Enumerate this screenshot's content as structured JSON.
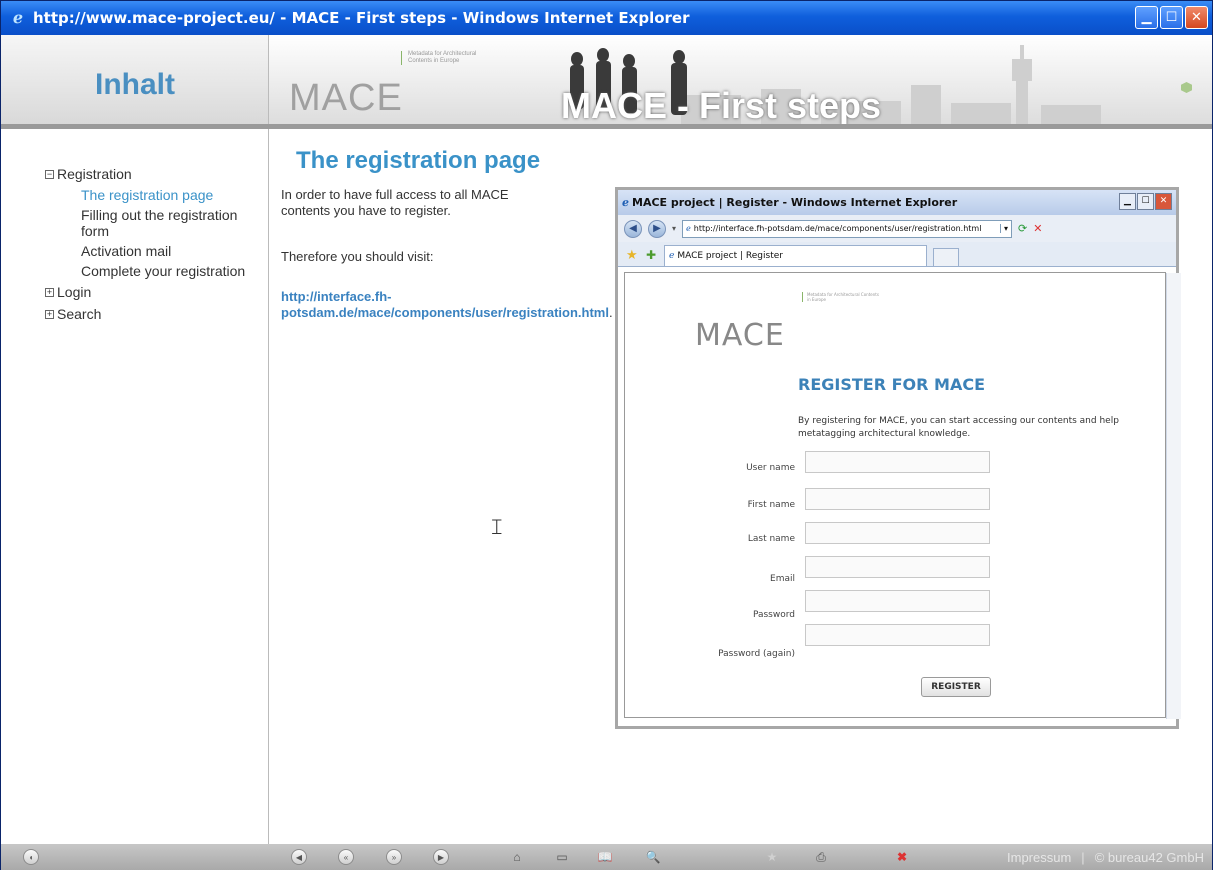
{
  "window": {
    "title": "http://www.mace-project.eu/ - MACE - First steps - Windows Internet Explorer"
  },
  "header": {
    "inhalt": "Inhalt",
    "logo": "MACE",
    "logo_tagline": "Metadata for Architectural Contents in Europe",
    "title": "MACE - First steps"
  },
  "nav": {
    "items": [
      {
        "box": "−",
        "label": "Registration",
        "children": [
          "The registration page",
          "Filling out the registration form",
          "Activation mail",
          "Complete your registration"
        ]
      },
      {
        "box": "+",
        "label": "Login"
      },
      {
        "box": "+",
        "label": "Search"
      }
    ]
  },
  "content": {
    "heading": "The registration page",
    "para1": "In order to have full access to all MACE contents you have to register.",
    "para2": "Therefore you should visit:",
    "link": "http://interface.fh-potsdam.de/mace/components/user/registration.html",
    "link_suffix": "."
  },
  "embedded_browser": {
    "title": "MACE project | Register - Windows Internet Explorer",
    "url": "http://interface.fh-potsdam.de/mace/components/user/registration.html",
    "tab": "MACE project | Register",
    "logo": "MACE",
    "logo_tagline": "Metadata for Architectural Contents in Europe",
    "heading": "REGISTER FOR MACE",
    "description": "By registering for MACE, you can start accessing our contents and help metatagging architectural knowledge.",
    "fields": [
      "User name",
      "First name",
      "Last name",
      "Email",
      "Password",
      "Password (again)"
    ],
    "submit": "REGISTER"
  },
  "footer": {
    "impressum": "Impressum",
    "separator": "|",
    "copyright": "© bureau42 GmbH"
  }
}
